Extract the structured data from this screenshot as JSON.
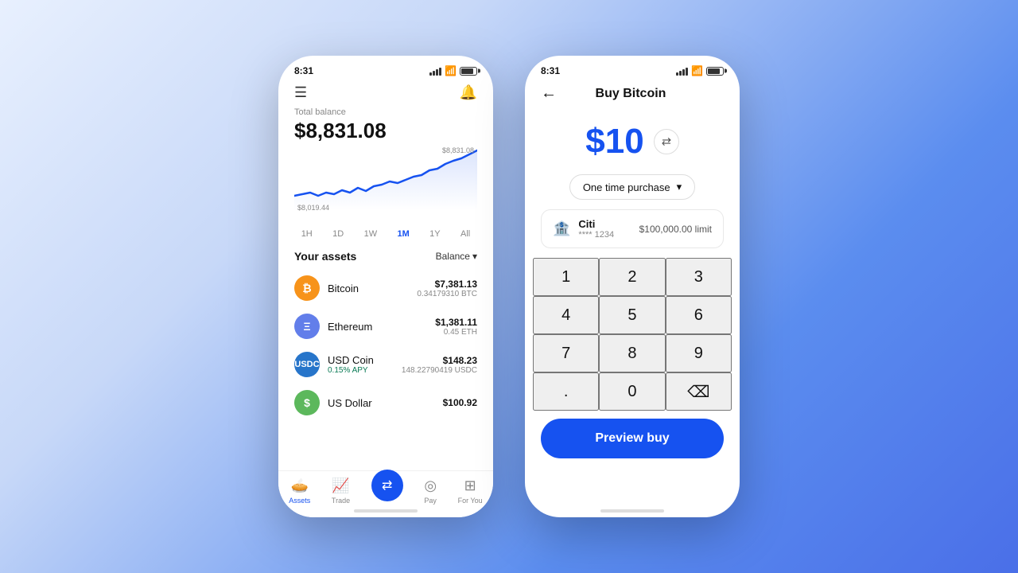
{
  "background": "linear-gradient(135deg, #e8f0fe, #4a6fe8)",
  "phone_left": {
    "status_time": "8:31",
    "total_balance_label": "Total balance",
    "total_balance": "$8,831.08",
    "chart_max": "$8,831.08",
    "chart_min": "$8,019.44",
    "time_filters": [
      "1H",
      "1D",
      "1W",
      "1M",
      "1Y",
      "All"
    ],
    "active_filter": "1M",
    "assets_title": "Your assets",
    "balance_dropdown": "Balance",
    "assets": [
      {
        "name": "Bitcoin",
        "symbol": "BTC",
        "icon": "₿",
        "icon_class": "asset-icon-btc",
        "fiat": "$7,381.13",
        "crypto": "0.34179310 BTC",
        "apy": null
      },
      {
        "name": "Ethereum",
        "symbol": "ETH",
        "icon": "Ξ",
        "icon_class": "asset-icon-eth",
        "fiat": "$1,381.11",
        "crypto": "0.45 ETH",
        "apy": null
      },
      {
        "name": "USD Coin",
        "symbol": "USDC",
        "icon": "◎",
        "icon_class": "asset-icon-usdc",
        "fiat": "$148.23",
        "crypto": "148.22790419 USDC",
        "apy": "0.15% APY"
      },
      {
        "name": "US Dollar",
        "symbol": "USD",
        "icon": "$",
        "icon_class": "asset-icon-usd",
        "fiat": "$100.92",
        "crypto": null,
        "apy": null
      }
    ],
    "nav_items": [
      {
        "label": "Assets",
        "icon": "◉",
        "active": true
      },
      {
        "label": "Trade",
        "icon": "📈",
        "active": false
      },
      {
        "label": "",
        "icon": "⇄",
        "active": false,
        "center": true
      },
      {
        "label": "Pay",
        "icon": "◎",
        "active": false
      },
      {
        "label": "For You",
        "icon": "⊞",
        "active": false
      }
    ]
  },
  "phone_right": {
    "status_time": "8:31",
    "screen_title": "Buy Bitcoin",
    "amount": "$10",
    "purchase_type_label": "One time purchase",
    "payment_name": "Citi",
    "payment_account": "**** 1234",
    "payment_limit": "$100,000.00 limit",
    "numpad": [
      "1",
      "2",
      "3",
      "4",
      "5",
      "6",
      "7",
      "8",
      "9",
      ".",
      "0",
      "⌫"
    ],
    "preview_btn_label": "Preview buy"
  }
}
